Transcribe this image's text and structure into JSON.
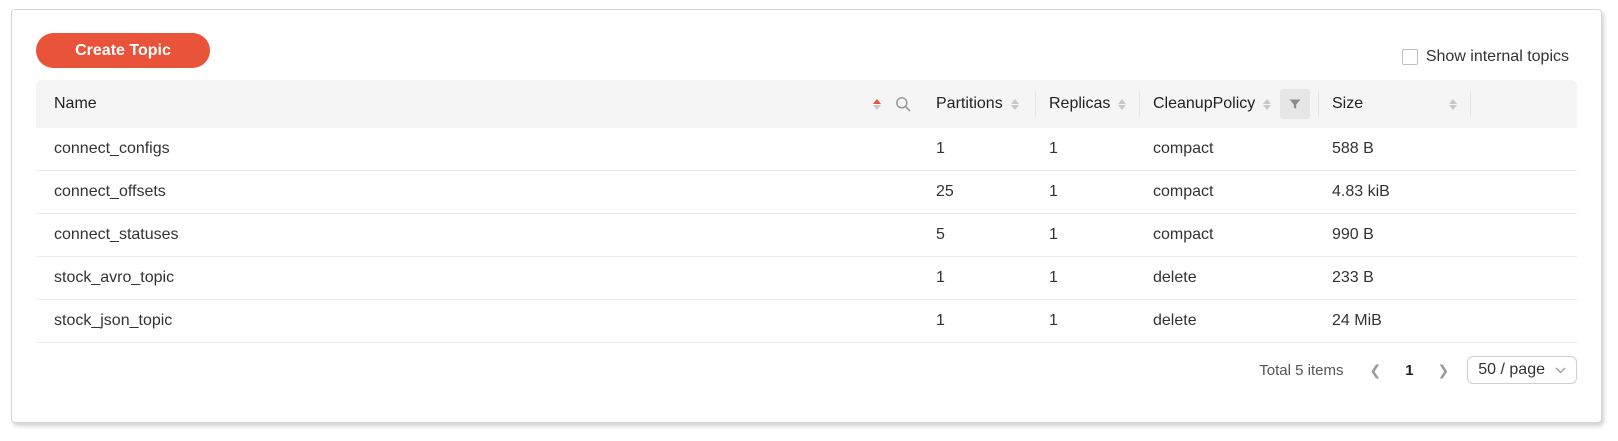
{
  "toolbar": {
    "create_label": "Create Topic",
    "show_internal_label": "Show internal topics"
  },
  "table": {
    "columns": {
      "name": "Name",
      "partitions": "Partitions",
      "replicas": "Replicas",
      "cleanup_policy": "CleanupPolicy",
      "size": "Size"
    },
    "rows": [
      {
        "name": "connect_configs",
        "partitions": "1",
        "replicas": "1",
        "cleanup_policy": "compact",
        "size": "588 B"
      },
      {
        "name": "connect_offsets",
        "partitions": "25",
        "replicas": "1",
        "cleanup_policy": "compact",
        "size": "4.83 kiB"
      },
      {
        "name": "connect_statuses",
        "partitions": "5",
        "replicas": "1",
        "cleanup_policy": "compact",
        "size": "990 B"
      },
      {
        "name": "stock_avro_topic",
        "partitions": "1",
        "replicas": "1",
        "cleanup_policy": "delete",
        "size": "233 B"
      },
      {
        "name": "stock_json_topic",
        "partitions": "1",
        "replicas": "1",
        "cleanup_policy": "delete",
        "size": "24 MiB"
      }
    ]
  },
  "pagination": {
    "total_label": "Total 5 items",
    "current_page": "1",
    "page_size": "50 / page",
    "prev_icon": "chevron-left-icon",
    "next_icon": "chevron-right-icon"
  },
  "colors": {
    "accent": "#e8533a",
    "header_bg": "#f5f5f5"
  }
}
